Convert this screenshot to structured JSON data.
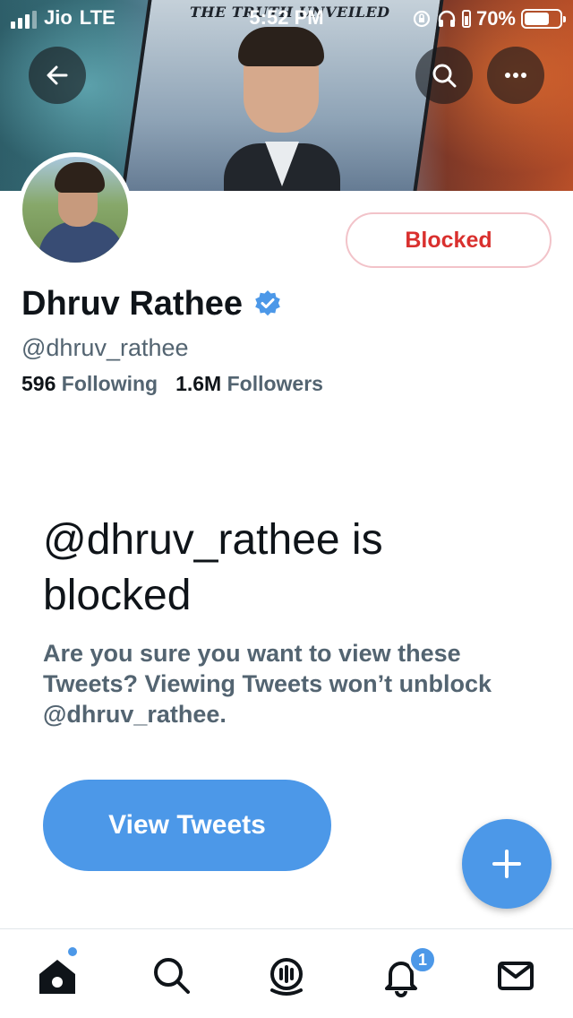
{
  "status_bar": {
    "carrier": "Jio",
    "network": "LTE",
    "time": "5:52 PM",
    "battery": "70%",
    "battery_level": 0.7
  },
  "banner": {
    "text": "THE TRUTH UNVEILED"
  },
  "header": {
    "back_icon": "arrow-left-icon",
    "search_icon": "search-icon",
    "more_icon": "more-horizontal-icon"
  },
  "profile": {
    "display_name": "Dhruv Rathee",
    "verified": true,
    "handle": "@dhruv_rathee",
    "following_count": "596",
    "following_label": "Following",
    "followers_count": "1.6M",
    "followers_label": "Followers",
    "block_status_label": "Blocked"
  },
  "blocked_notice": {
    "title": "@dhruv_rathee is blocked",
    "description": "Are you sure you want to view these Tweets? Viewing Tweets won’t unblock @dhruv_rathee.",
    "view_button_label": "View Tweets"
  },
  "fab": {
    "icon": "plus-icon"
  },
  "bottom_nav": {
    "items": [
      {
        "name": "home",
        "icon": "home-icon",
        "active": true
      },
      {
        "name": "search",
        "icon": "search-icon"
      },
      {
        "name": "spaces",
        "icon": "spaces-icon"
      },
      {
        "name": "notifications",
        "icon": "bell-icon",
        "badge": "1"
      },
      {
        "name": "messages",
        "icon": "mail-icon"
      }
    ]
  },
  "colors": {
    "accent": "#4c98e8",
    "blocked_red": "#d9302e",
    "blocked_border": "#f2c3c9",
    "secondary_text": "#536471"
  }
}
